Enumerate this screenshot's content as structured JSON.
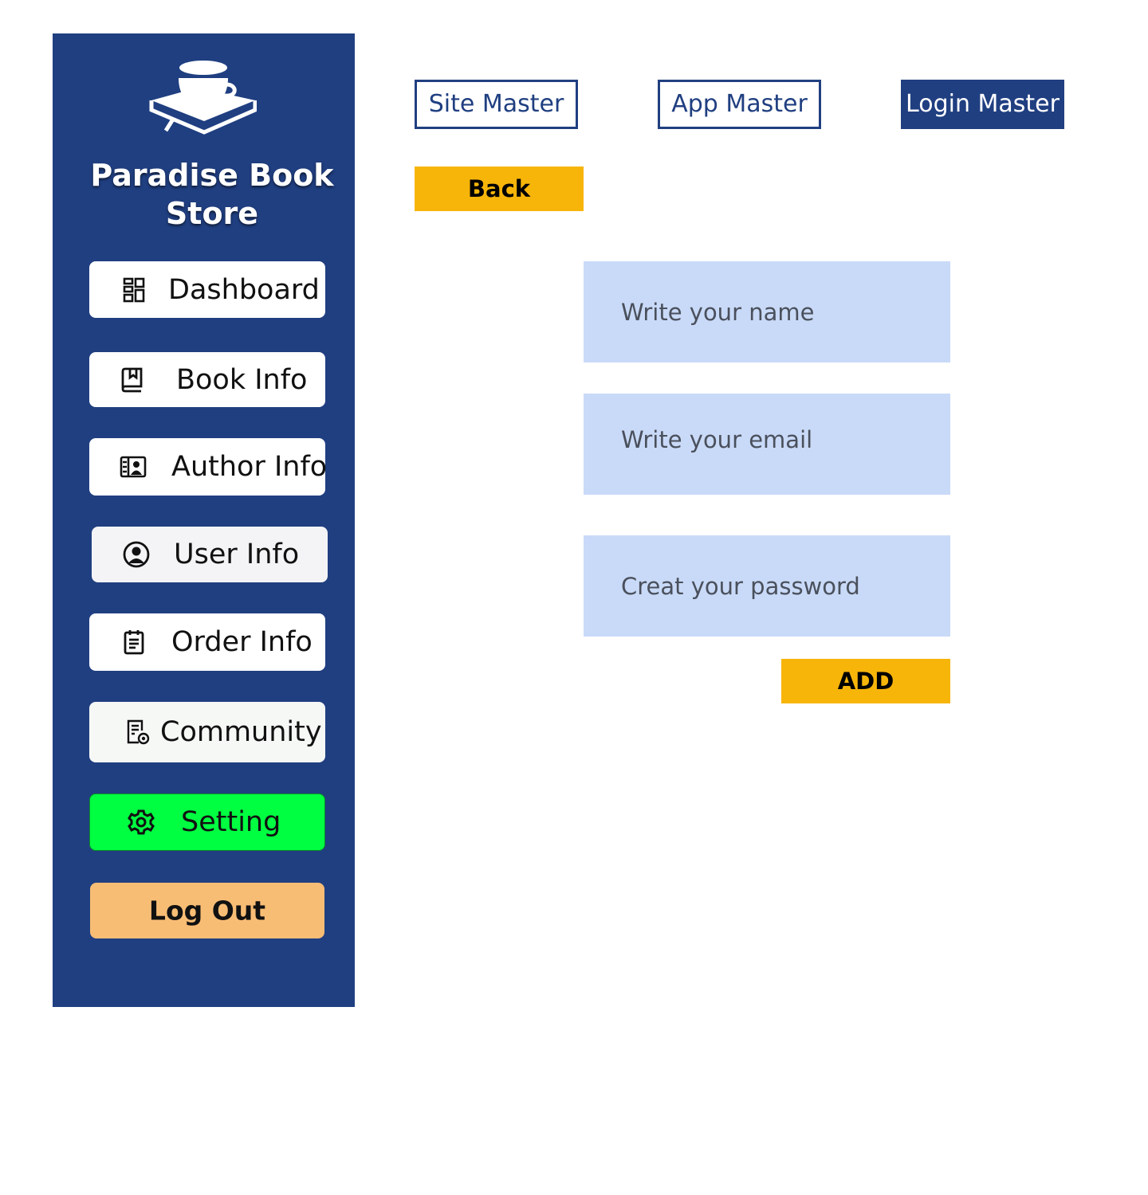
{
  "brand": {
    "title": "Paradise Book Store",
    "logo": "book-cup-logo"
  },
  "sidebar": {
    "items": [
      {
        "label": "Dashboard",
        "icon": "dashboard-icon"
      },
      {
        "label": "Book Info",
        "icon": "book-icon"
      },
      {
        "label": "Author Info",
        "icon": "author-card-icon"
      },
      {
        "label": "User Info",
        "icon": "user-circle-icon"
      },
      {
        "label": "Order Info",
        "icon": "clipboard-icon"
      },
      {
        "label": "Community",
        "icon": "document-view-icon"
      },
      {
        "label": "Setting",
        "icon": "gear-icon"
      }
    ],
    "logout_label": "Log Out"
  },
  "tabs": [
    {
      "label": "Site Master",
      "active": false
    },
    {
      "label": "App Master",
      "active": false
    },
    {
      "label": "Login Master",
      "active": true
    }
  ],
  "back_label": "Back",
  "form": {
    "name_placeholder": "Write your name",
    "email_placeholder": "Write your email",
    "password_placeholder": "Creat your password",
    "add_label": "ADD"
  },
  "colors": {
    "sidebar": "#203f81",
    "accent_yellow": "#f7b50a",
    "setting_active": "#00ff41",
    "logout": "#f8bd75",
    "field_bg": "#c9daf8"
  }
}
